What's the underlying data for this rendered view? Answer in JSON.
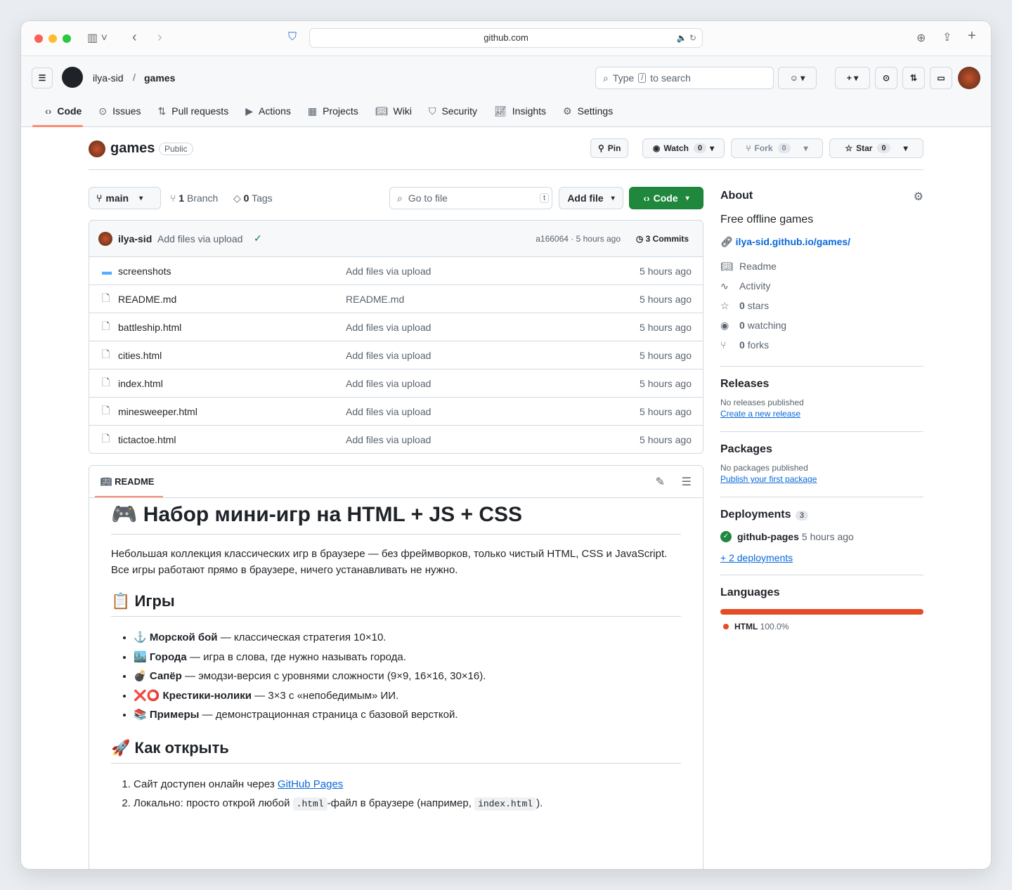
{
  "browser": {
    "url": "github.com"
  },
  "header": {
    "owner": "ilya-sid",
    "repo": "games",
    "search_prefix": "Type",
    "search_key": "/",
    "search_suffix": "to search"
  },
  "tabs": [
    {
      "label": "Code",
      "icon": "code-icon"
    },
    {
      "label": "Issues",
      "icon": "issue-icon"
    },
    {
      "label": "Pull requests",
      "icon": "pr-icon"
    },
    {
      "label": "Actions",
      "icon": "play-icon"
    },
    {
      "label": "Projects",
      "icon": "table-icon"
    },
    {
      "label": "Wiki",
      "icon": "book-icon"
    },
    {
      "label": "Security",
      "icon": "shield-icon"
    },
    {
      "label": "Insights",
      "icon": "graph-icon"
    },
    {
      "label": "Settings",
      "icon": "gear-icon"
    }
  ],
  "repo": {
    "name": "games",
    "visibility": "Public",
    "pin": "Pin",
    "watch": "Watch",
    "watch_count": "0",
    "fork": "Fork",
    "fork_count": "0",
    "star": "Star",
    "star_count": "0"
  },
  "toolbar": {
    "branch": "main",
    "branches": "1",
    "branches_label": "Branch",
    "tags": "0",
    "tags_label": "Tags",
    "goto": "Go to file",
    "goto_key": "t",
    "add_file": "Add file",
    "code": "Code"
  },
  "commit": {
    "author": "ilya-sid",
    "message": "Add files via upload",
    "hash": "a166064 · 5 hours ago",
    "commits": "3 Commits"
  },
  "files": [
    {
      "name": "screenshots",
      "type": "folder",
      "message": "Add files via upload",
      "time": "5 hours ago"
    },
    {
      "name": "README.md",
      "type": "file",
      "message": "README.md",
      "time": "5 hours ago"
    },
    {
      "name": "battleship.html",
      "type": "file",
      "message": "Add files via upload",
      "time": "5 hours ago"
    },
    {
      "name": "cities.html",
      "type": "file",
      "message": "Add files via upload",
      "time": "5 hours ago"
    },
    {
      "name": "index.html",
      "type": "file",
      "message": "Add files via upload",
      "time": "5 hours ago"
    },
    {
      "name": "minesweeper.html",
      "type": "file",
      "message": "Add files via upload",
      "time": "5 hours ago"
    },
    {
      "name": "tictactoe.html",
      "type": "file",
      "message": "Add files via upload",
      "time": "5 hours ago"
    }
  ],
  "readme": {
    "tab": "README",
    "title": "🎮 Набор мини-игр на HTML + JS + CSS",
    "p1": "Небольшая коллекция классических игр в браузере — без фреймворков, только чистый HTML, CSS и JavaScript.",
    "p2": "Все игры работают прямо в браузере, ничего устанавливать не нужно.",
    "h_games": "📋 Игры",
    "games": [
      {
        "emoji": "⚓",
        "name": "Морской бой",
        "desc": " — классическая стратегия 10×10."
      },
      {
        "emoji": "🏙️",
        "name": "Города",
        "desc": " — игра в слова, где нужно называть города."
      },
      {
        "emoji": "💣",
        "name": "Сапёр",
        "desc": " — эмодзи-версия с уровнями сложности (9×9, 16×16, 30×16)."
      },
      {
        "emoji": "❌⭕",
        "name": "Крестики-нолики",
        "desc": " — 3×3 с «непобедимым» ИИ."
      },
      {
        "emoji": "📚",
        "name": "Примеры",
        "desc": " — демонстрационная страница с базовой версткой."
      }
    ],
    "h_open": "🚀 Как открыть",
    "s1_pre": "Сайт доступен онлайн через ",
    "s1_link": "GitHub Pages",
    "s2_pre": "Локально: просто открой любой ",
    "s2_code1": ".html",
    "s2_mid": "-файл в браузере (например, ",
    "s2_code2": "index.html",
    "s2_post": ")."
  },
  "about": {
    "title": "About",
    "description": "Free offline games",
    "website": "ilya-sid.github.io/games/",
    "items": [
      {
        "icon": "book-icon",
        "bold": "",
        "label": "Readme"
      },
      {
        "icon": "pulse-icon",
        "bold": "",
        "label": "Activity"
      },
      {
        "icon": "star-icon",
        "bold": "0",
        "label": "stars"
      },
      {
        "icon": "eye-icon",
        "bold": "0",
        "label": "watching"
      },
      {
        "icon": "fork-icon",
        "bold": "0",
        "label": "forks"
      }
    ]
  },
  "releases": {
    "title": "Releases",
    "none": "No releases published",
    "link": "Create a new release"
  },
  "packages": {
    "title": "Packages",
    "none": "No packages published",
    "link": "Publish your first package"
  },
  "deployments": {
    "title": "Deployments",
    "count": "3",
    "env": "github-pages",
    "time": "5 hours ago",
    "more": "+ 2 deployments"
  },
  "languages": {
    "title": "Languages",
    "items": [
      {
        "name": "HTML",
        "percent": "100.0%",
        "value": 100,
        "color": "#e34c26"
      }
    ]
  }
}
